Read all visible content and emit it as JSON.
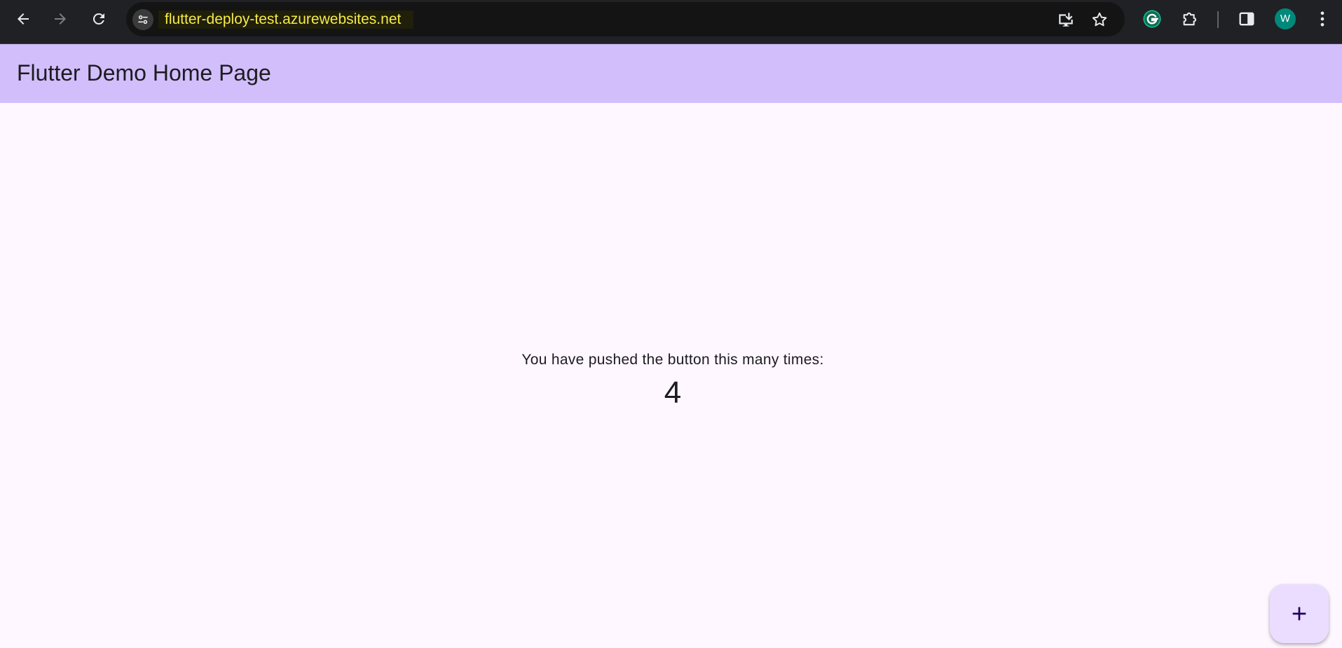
{
  "browser": {
    "url": "flutter-deploy-test.azurewebsites.net",
    "profile_initial": "W",
    "icons": {
      "back": "arrow-left-icon",
      "forward": "arrow-right-icon",
      "reload": "reload-icon",
      "site_info": "tune-icon",
      "install": "install-app-icon",
      "bookmark": "star-icon",
      "grammarly": "grammarly-icon",
      "extensions": "puzzle-icon",
      "side_panel": "side-panel-icon",
      "menu": "more-vert-icon"
    }
  },
  "app": {
    "title": "Flutter Demo Home Page",
    "counter_label": "You have pushed the button this many times:",
    "counter_value": "4",
    "fab_icon": "add-icon"
  },
  "colors": {
    "chrome_bg": "#202124",
    "url_text": "#f7e94a",
    "app_bar": "#d1befb",
    "page_bg": "#fef7ff",
    "fab_bg": "#eaddff",
    "fab_icon": "#21005d",
    "avatar_bg": "#00897b",
    "grammarly": "#15c39a"
  }
}
